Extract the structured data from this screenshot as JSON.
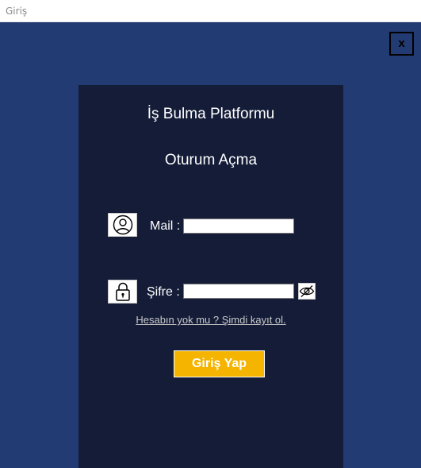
{
  "window": {
    "title": "Giriş",
    "close_label": "x"
  },
  "panel": {
    "platform_title": "İş Bulma Platformu",
    "form_title": "Oturum Açma",
    "mail_label": "Mail :",
    "mail_value": "",
    "password_label": "Şifre :",
    "password_value": "",
    "register_link": "Hesabın yok mu ? Şimdi kayıt ol.",
    "login_button": "Giriş Yap"
  },
  "icons": {
    "user": "user-icon",
    "lock": "lock-icon",
    "eye": "eye-slash-icon"
  },
  "colors": {
    "background": "#233b73",
    "panel": "#141c38",
    "button": "#f5b400"
  }
}
